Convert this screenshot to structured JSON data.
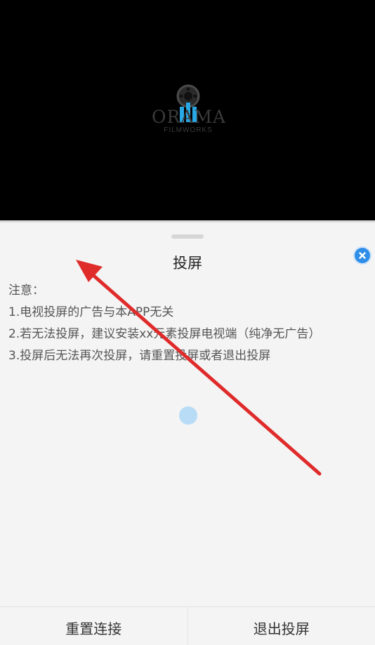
{
  "video": {
    "logo": {
      "wordmark": "ORAMA",
      "subtitle": "FILMWORKS"
    }
  },
  "sheet": {
    "title": "投屏",
    "close_icon": "close-icon",
    "notes": [
      "注意：",
      "1.电视投屏的广告与本APP无关",
      "2.若无法投屏，建议安装xx元素投屏电视端（纯净无广告）",
      "3.投屏后无法再次投屏，请重置投屏或者退出投屏"
    ],
    "loading_icon": "loading-spinner-icon"
  },
  "buttons": {
    "reset": "重置连接",
    "exit": "退出投屏"
  },
  "colors": {
    "accent": "#2f8ee8",
    "annotation_arrow": "#e02b2b"
  }
}
